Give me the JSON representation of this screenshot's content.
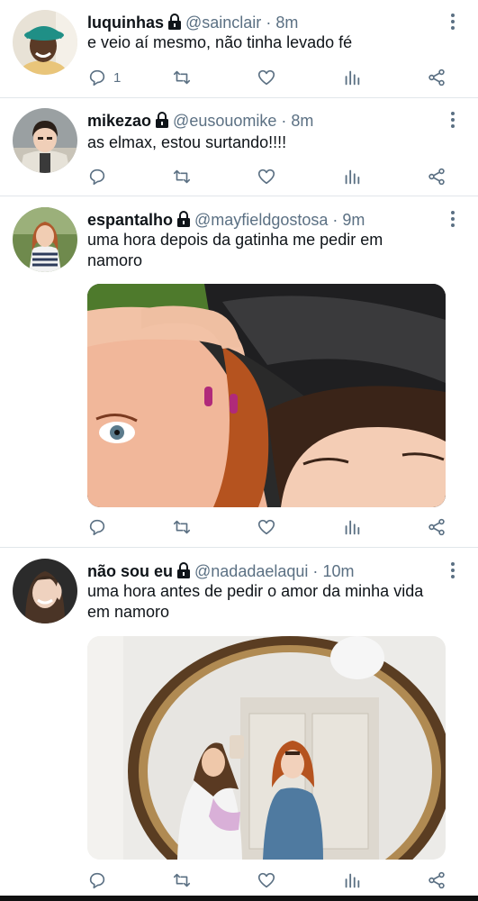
{
  "tweets": [
    {
      "name": "luquinhas",
      "handle": "@sainclair",
      "dot": "·",
      "time": "8m",
      "text": "e veio aí mesmo, não tinha levado fé",
      "reply_count": "1"
    },
    {
      "name": "mikezao",
      "handle": "@eusouomike",
      "dot": "·",
      "time": "8m",
      "text": "as elmax, estou surtando!!!!",
      "reply_count": ""
    },
    {
      "name": "espantalho",
      "handle": "@mayfieldgostosa",
      "dot": "·",
      "time": "9m",
      "text": "uma hora depois da gatinha me pedir em namoro",
      "reply_count": ""
    },
    {
      "name": "não sou eu",
      "handle": "@nadadaelaqui",
      "dot": "·",
      "time": "10m",
      "text": "uma hora antes de pedir o amor da minha vida em namoro",
      "reply_count": ""
    }
  ],
  "icons": {
    "reply": "reply-icon",
    "retweet": "retweet-icon",
    "like": "heart-icon",
    "stats": "stats-icon",
    "share": "share-icon",
    "lock": "lock-icon",
    "more": "more-icon"
  },
  "colors": {
    "text": "#0f1419",
    "secondary": "#5b7083",
    "separator": "#e1e6ea"
  }
}
